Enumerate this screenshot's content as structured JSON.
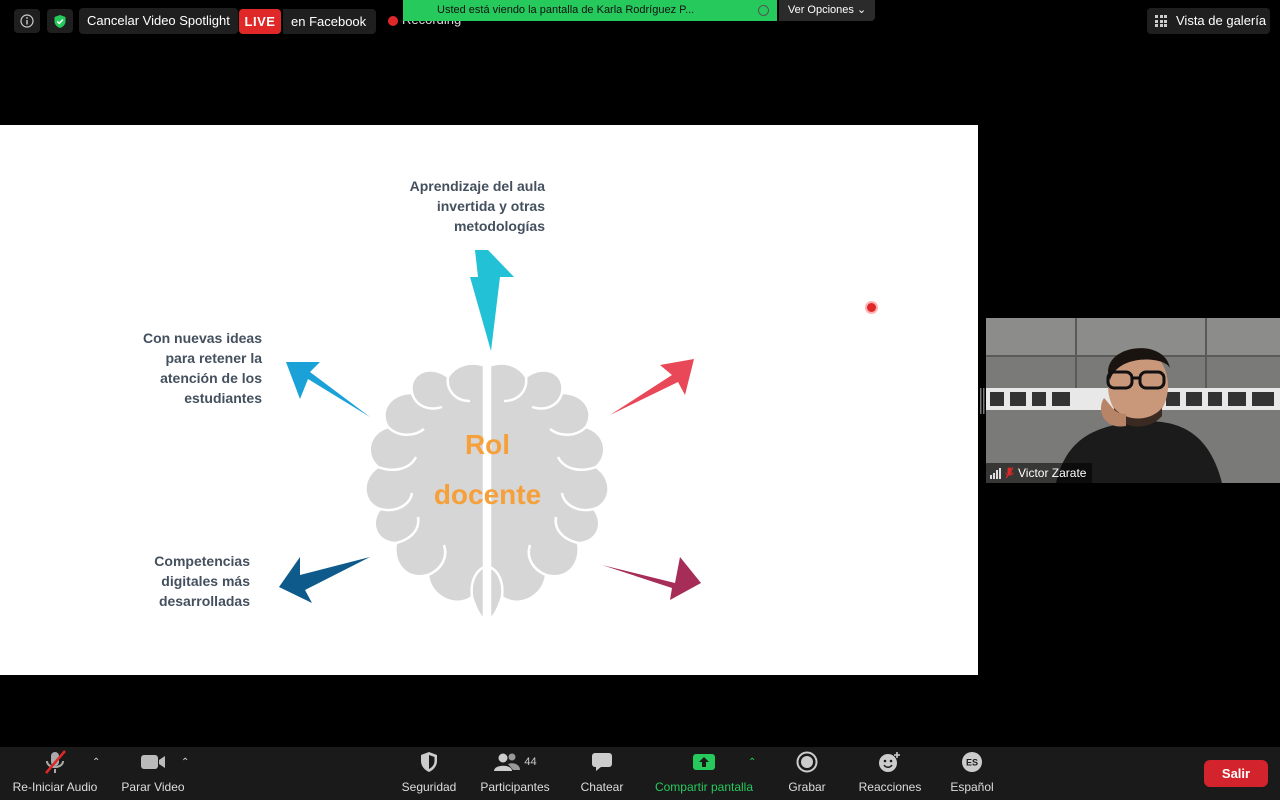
{
  "top_bar": {
    "spotlight_label": "Cancelar Video Spotlight",
    "live_badge": "LIVE",
    "live_destination": "en Facebook",
    "recording_label": "Recording",
    "share_banner": "Usted está viendo la pantalla de Karla Rodríguez P...",
    "view_options_label": "Ver Opciones ⌄",
    "gallery_label": "Vista de galería"
  },
  "slide": {
    "center_title_line1": "Rol",
    "center_title_line2": "docente",
    "labels": {
      "top": "Aprendizaje del aula invertida y otras metodologías",
      "left_top": "Con nuevas ideas para retener la atención de los estudiantes",
      "left_bottom": "Competencias digitales más desarrolladas"
    },
    "arrow_colors": {
      "top": "#22c1d6",
      "left_top": "#1aa1d8",
      "right_top": "#e94858",
      "left_bottom": "#0e5a8a",
      "right_bottom": "#a62d57"
    },
    "title_color": "#f5a03a",
    "brain_color": "#d6d6d6"
  },
  "participant": {
    "name": "Victor Zarate"
  },
  "toolbar": {
    "audio_label": "Re-Iniciar Audio",
    "video_label": "Parar Video",
    "security_label": "Seguridad",
    "participants_label": "Participantes",
    "participants_count": "44",
    "chat_label": "Chatear",
    "share_label": "Compartir pantalla",
    "record_label": "Grabar",
    "reactions_label": "Reacciones",
    "language_code": "ES",
    "language_label": "Español",
    "leave_label": "Salir"
  },
  "colors": {
    "share_green": "#26c95c",
    "live_red": "#e02828",
    "leave_red": "#d3232d"
  }
}
